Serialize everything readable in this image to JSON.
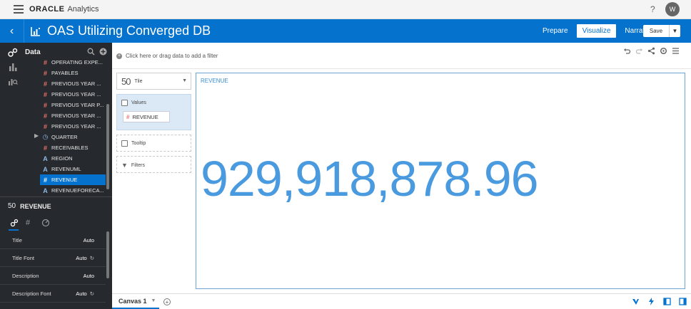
{
  "topbar": {
    "brand_oracle": "ORACLE",
    "brand_app": "Analytics",
    "help": "?",
    "avatar_initial": "W"
  },
  "header": {
    "title": "OAS Utilizing Converged DB",
    "modes": [
      "Prepare",
      "Visualize",
      "Narrate"
    ],
    "active_mode": "Visualize",
    "save_label": "Save"
  },
  "data_panel": {
    "title": "Data",
    "items": [
      {
        "label": "OPERATING EXPE...",
        "type": "number"
      },
      {
        "label": "PAYABLES",
        "type": "number"
      },
      {
        "label": "PREVIOUS YEAR ...",
        "type": "number"
      },
      {
        "label": "PREVIOUS YEAR ...",
        "type": "number"
      },
      {
        "label": "PREVIOUS YEAR P...",
        "type": "number"
      },
      {
        "label": "PREVIOUS YEAR ...",
        "type": "number"
      },
      {
        "label": "PREVIOUS YEAR ...",
        "type": "number"
      },
      {
        "label": "QUARTER",
        "type": "time"
      },
      {
        "label": "RECEIVABLES",
        "type": "number"
      },
      {
        "label": "REGION",
        "type": "text"
      },
      {
        "label": "REVENUML",
        "type": "text"
      },
      {
        "label": "REVENUE",
        "type": "number",
        "selected": true
      },
      {
        "label": "REVENUEFORECA...",
        "type": "text"
      }
    ]
  },
  "properties": {
    "symbol": "50",
    "element_name": "REVENUE",
    "rows": [
      {
        "label": "Title",
        "value": "Auto"
      },
      {
        "label": "Title Font",
        "value": "Auto"
      },
      {
        "label": "Description",
        "value": "Auto"
      },
      {
        "label": "Description Font",
        "value": "Auto"
      }
    ]
  },
  "filter_bar": {
    "placeholder": "Click here or drag data to add a filter"
  },
  "grammar": {
    "viz_symbol": "50",
    "viz_type": "Tile",
    "values_label": "Values",
    "values_chip": "REVENUE",
    "tooltip_label": "Tooltip",
    "filters_label": "Filters"
  },
  "canvas": {
    "title": "REVENUE",
    "value": "929,918,878.96"
  },
  "bottom": {
    "canvas_tab": "Canvas 1"
  },
  "colors": {
    "header_blue": "#0572ce",
    "tile_value": "#4a9ae0",
    "measure_glyph": "#f0736a",
    "dark_panel": "#262a2e"
  }
}
